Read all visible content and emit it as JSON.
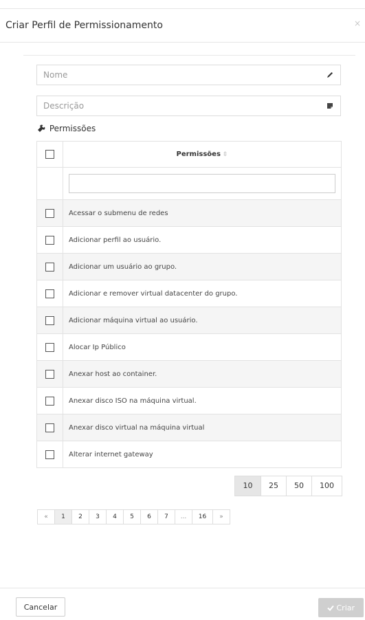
{
  "modal": {
    "title": "Criar Perfil de Permissionamento",
    "close_symbol": "×"
  },
  "form": {
    "name_placeholder": "Nome",
    "name_icon": "pencil-icon",
    "description_placeholder": "Descrição",
    "description_icon": "note-icon",
    "permissions_label": "Permissões",
    "permissions_icon": "wrench-icon"
  },
  "table": {
    "column_header": "Permissões",
    "sort_symbol": "⇳",
    "filter_value": "",
    "rows": [
      {
        "label": "Acessar o submenu de redes",
        "checked": false
      },
      {
        "label": "Adicionar perfil ao usuário.",
        "checked": false
      },
      {
        "label": "Adicionar um usuário ao grupo.",
        "checked": false
      },
      {
        "label": "Adicionar e remover virtual datacenter do grupo.",
        "checked": false
      },
      {
        "label": "Adicionar máquina virtual ao usuário.",
        "checked": false
      },
      {
        "label": "Alocar Ip Público",
        "checked": false
      },
      {
        "label": "Anexar host ao container.",
        "checked": false
      },
      {
        "label": "Anexar disco ISO na máquina virtual.",
        "checked": false
      },
      {
        "label": "Anexar disco virtual na máquina virtual",
        "checked": false
      },
      {
        "label": "Alterar internet gateway",
        "checked": false
      }
    ]
  },
  "page_size": {
    "options": [
      "10",
      "25",
      "50",
      "100"
    ],
    "selected": "10"
  },
  "pagination": {
    "prev": "«",
    "pages": [
      "1",
      "2",
      "3",
      "4",
      "5",
      "6",
      "7",
      "...",
      "16"
    ],
    "current": "1",
    "next": "»"
  },
  "footer": {
    "cancel_label": "Cancelar",
    "create_label": "Criar",
    "create_icon": "checkmark-icon"
  }
}
